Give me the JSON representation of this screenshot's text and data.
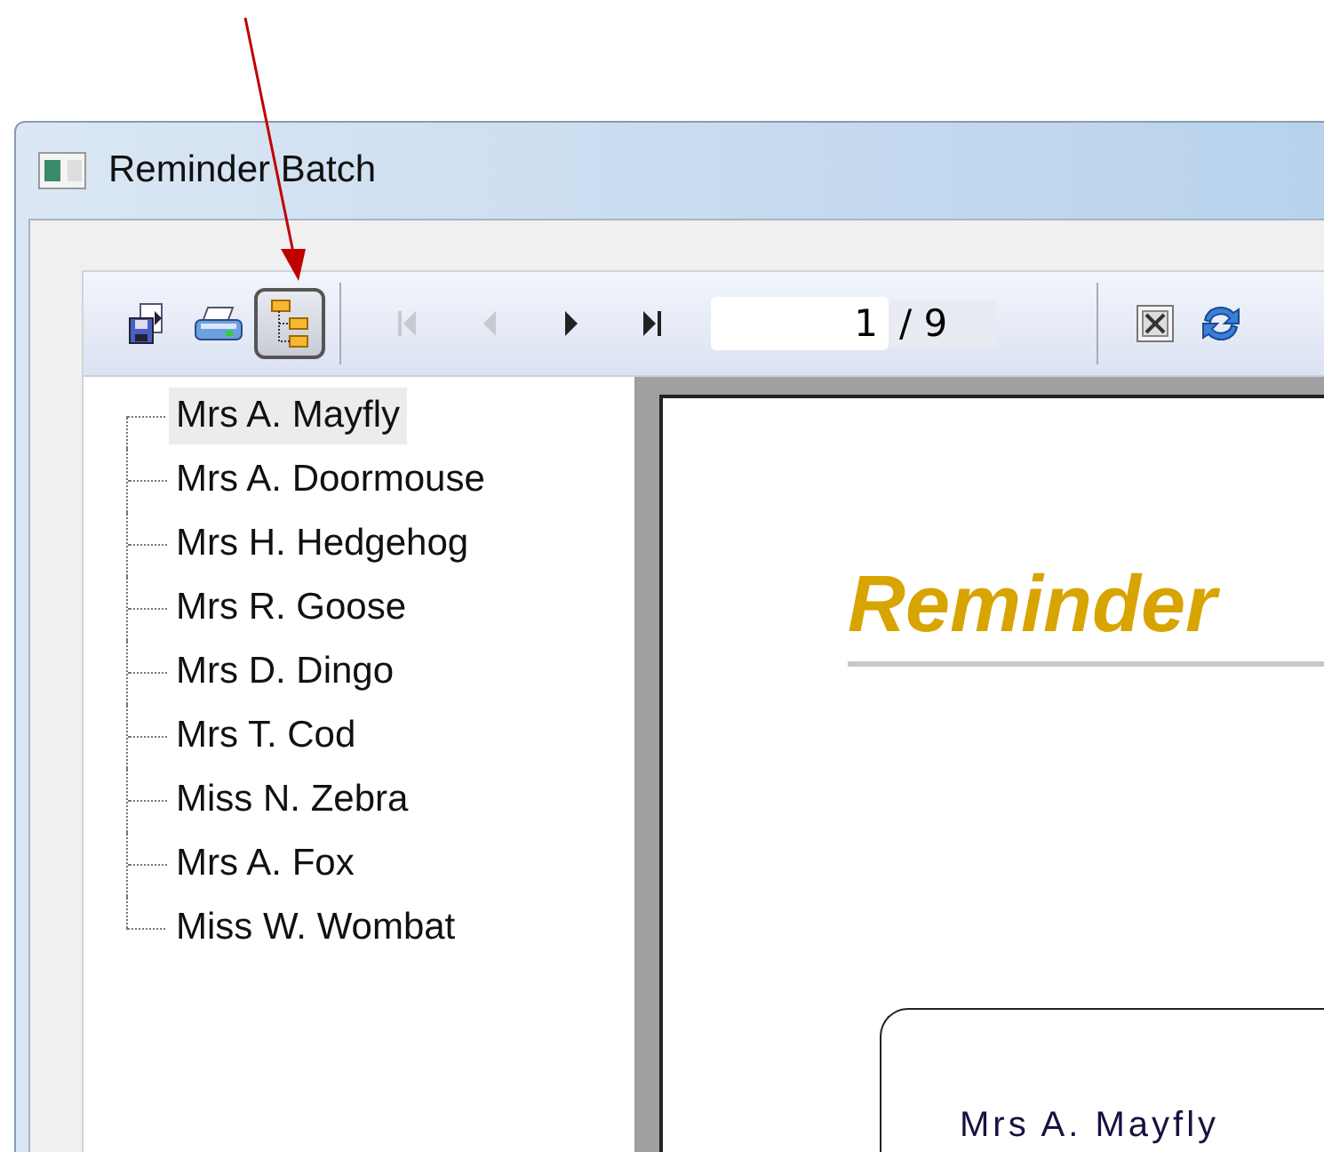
{
  "window": {
    "title": "Reminder Batch"
  },
  "toolbar": {
    "buttons": [
      {
        "kind": "export",
        "pressed": false,
        "disabled": false
      },
      {
        "kind": "print",
        "pressed": false,
        "disabled": false
      },
      {
        "kind": "tree",
        "pressed": true,
        "disabled": false
      },
      {
        "kind": "first",
        "pressed": false,
        "disabled": true
      },
      {
        "kind": "prev",
        "pressed": false,
        "disabled": true
      },
      {
        "kind": "next",
        "pressed": false,
        "disabled": false
      },
      {
        "kind": "last",
        "pressed": false,
        "disabled": false
      }
    ],
    "page_field": {
      "value": "1"
    },
    "page_total": "/ 9",
    "tools": [
      {
        "kind": "close-doc"
      },
      {
        "kind": "refresh"
      }
    ]
  },
  "tree": {
    "items": [
      {
        "label": "Mrs A. Mayfly",
        "selected": true
      },
      {
        "label": "Mrs A. Doormouse",
        "selected": false
      },
      {
        "label": "Mrs H. Hedgehog",
        "selected": false
      },
      {
        "label": "Mrs R. Goose",
        "selected": false
      },
      {
        "label": "Mrs D. Dingo",
        "selected": false
      },
      {
        "label": "Mrs T. Cod",
        "selected": false
      },
      {
        "label": "Miss N. Zebra",
        "selected": false
      },
      {
        "label": "Mrs A. Fox",
        "selected": false
      },
      {
        "label": "Miss W. Wombat",
        "selected": false
      }
    ]
  },
  "preview": {
    "title": "Reminder",
    "address_name": "Mrs A. Mayfly"
  }
}
